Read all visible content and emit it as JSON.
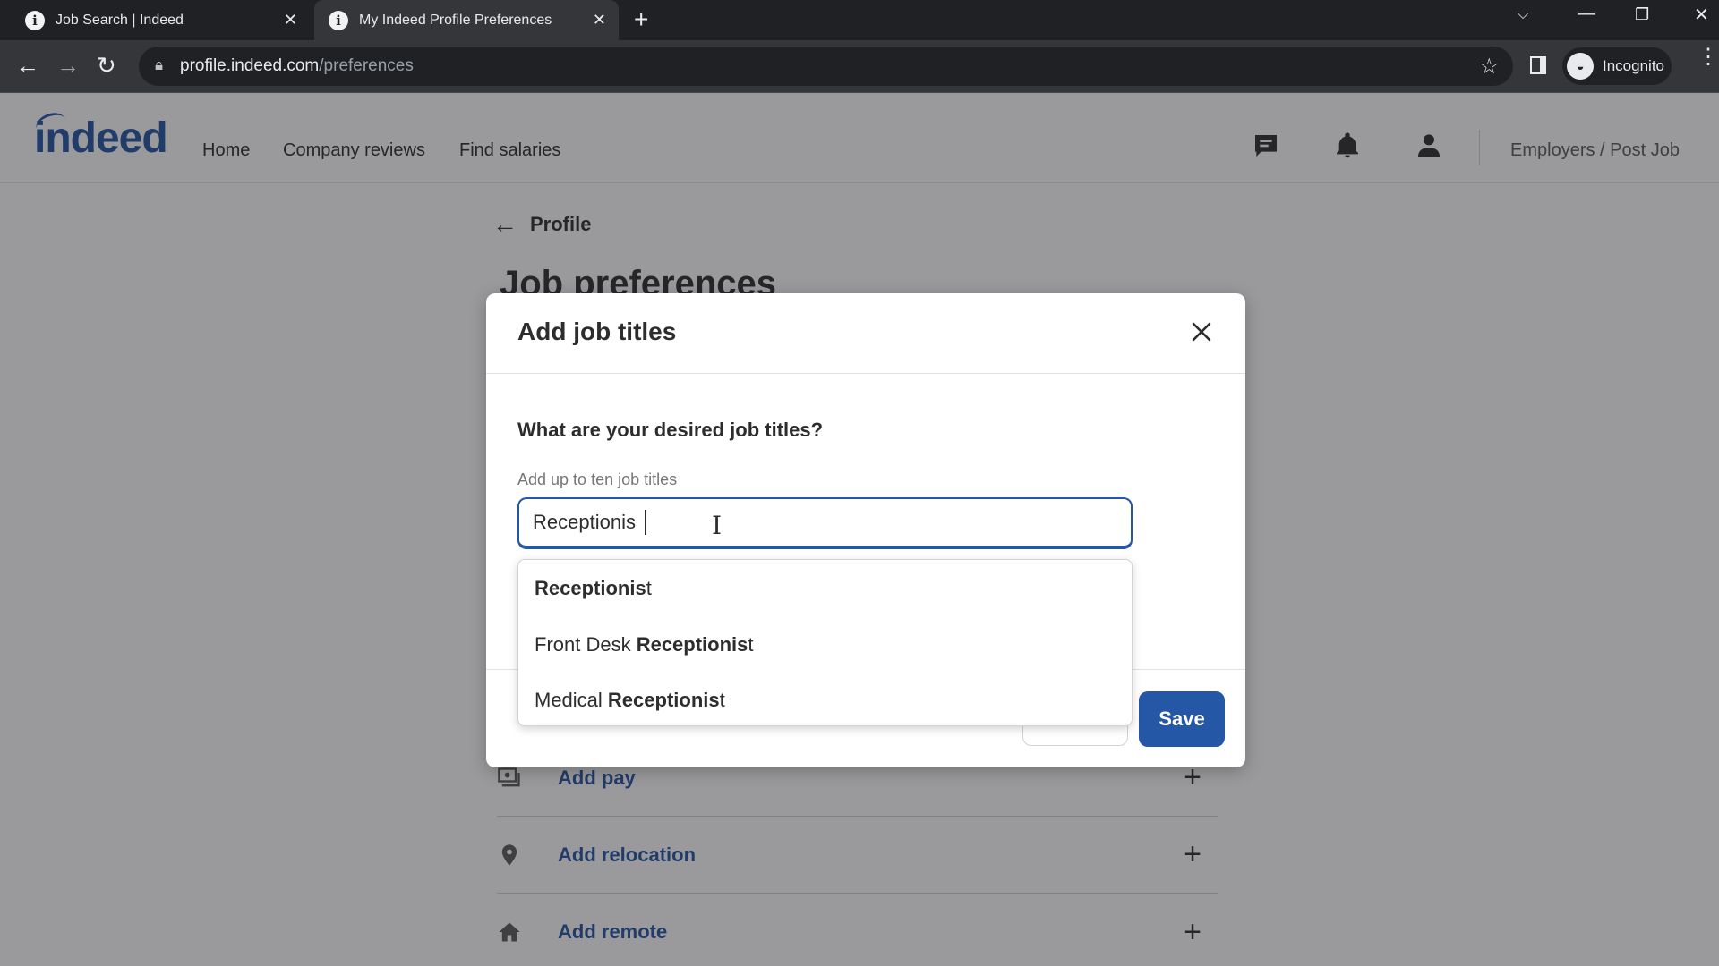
{
  "browser": {
    "tabs": [
      {
        "title": "Job Search | Indeed",
        "active": false
      },
      {
        "title": "My Indeed Profile Preferences",
        "active": true
      }
    ],
    "url_host": "profile.indeed.com",
    "url_path": "/preferences",
    "incognito_label": "Incognito"
  },
  "site": {
    "logo": "indeed",
    "nav": [
      "Home",
      "Company reviews",
      "Find salaries"
    ],
    "icons": [
      "messages-icon",
      "notifications-icon",
      "account-icon"
    ],
    "employers_link": "Employers / Post Job",
    "brand_color": "#2557a7"
  },
  "page": {
    "back_label": "Profile",
    "title": "Job preferences",
    "rows": [
      {
        "label": "Add pay",
        "icon": "pay-icon"
      },
      {
        "label": "Add relocation",
        "icon": "location-pin-icon"
      },
      {
        "label": "Add remote",
        "icon": "home-icon"
      }
    ]
  },
  "modal": {
    "title": "Add job titles",
    "question": "What are your desired job titles?",
    "hint": "Add up to ten job titles",
    "input_value": "Receptionis",
    "suggestions": [
      {
        "prefix": "",
        "match": "Receptionis",
        "suffix": "t"
      },
      {
        "prefix": "Front Desk ",
        "match": "Receptionis",
        "suffix": "t"
      },
      {
        "prefix": "Medical ",
        "match": "Receptionis",
        "suffix": "t"
      }
    ],
    "save_label": "Save"
  }
}
